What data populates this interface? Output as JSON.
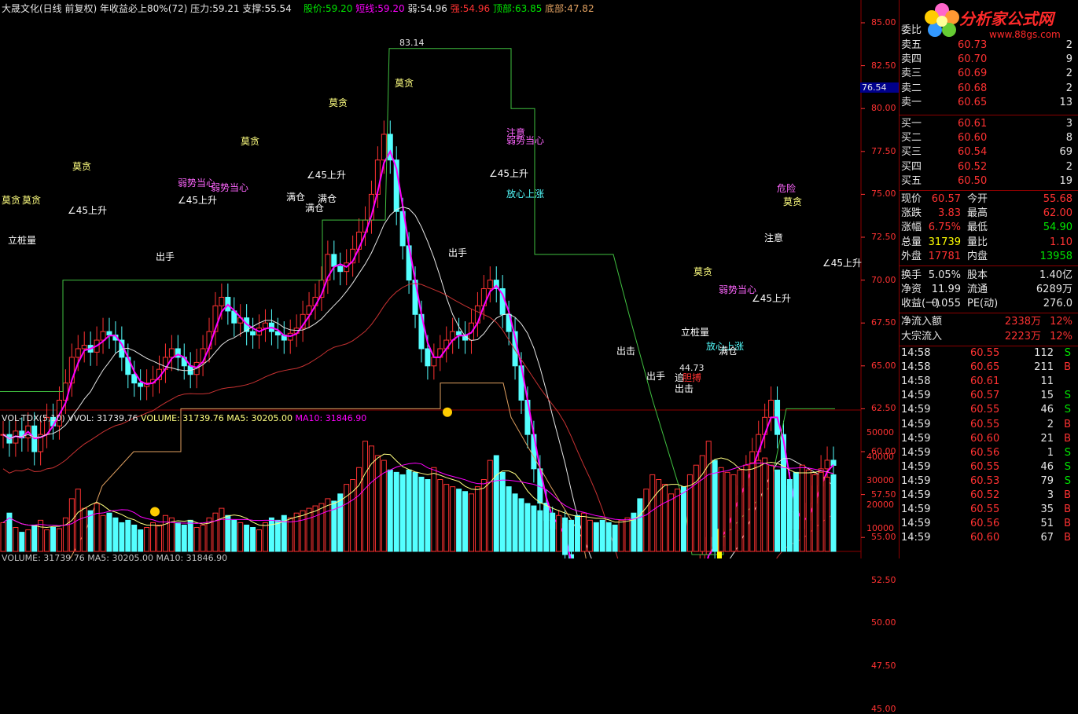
{
  "header": {
    "stock": "大晟文化(日线 前复权)",
    "indicator": "年收益必上80%(72)",
    "pressure_label": "压力:",
    "pressure": "59.21",
    "support_label": "支撑:",
    "support": "55.54",
    "price_label": "股价:",
    "price": "59.20",
    "short_label": "短线:",
    "short": "59.20",
    "weak_label": "弱:",
    "weak": "54.96",
    "strong_label": "强:",
    "strong": "54.96",
    "top_label": "顶部:",
    "top": "63.85",
    "bottom_label": "底部:",
    "bottom": "47.82"
  },
  "price_axis": [
    "85.00",
    "82.50",
    "80.00",
    "77.50",
    "75.00",
    "72.50",
    "70.00",
    "67.50",
    "65.00",
    "62.50",
    "60.00",
    "57.50",
    "55.00",
    "52.50",
    "50.00",
    "47.50",
    "45.00"
  ],
  "price_marker": "76.54",
  "volume_axis": [
    "50000",
    "40000",
    "30000",
    "20000",
    "10000"
  ],
  "volume_header": {
    "name": "VOL-TDX(5,10)",
    "vvol": "VVOL: 31739.76",
    "volume": "VOLUME: 31739.76",
    "ma5": "MA5: 30205.00",
    "ma10": "MA10: 31846.90"
  },
  "volume_footer": "VOLUME: 31739.76  MA5: 30205.00  MA10: 31846.90",
  "annotations": {
    "high": "83.14",
    "low": "44.73",
    "labels": [
      "莫贪",
      "莫贪",
      "立桩量",
      "莫贪",
      "∠45上升",
      "出手",
      "莫贪",
      "弱势当心",
      "∠45上升",
      "弱势当心",
      "满仓",
      "满仓",
      "满仓",
      "莫贪",
      "∠45上升",
      "莫贪",
      "出手",
      "注意",
      "弱势当心",
      "∠45上升",
      "放心上涨",
      "出击",
      "出手",
      "追",
      "胆搏",
      "出击",
      "立桩量",
      "莫贪",
      "弱势当心",
      "放心上涨",
      "满仓",
      "∠45上升",
      "注意",
      "危险",
      "莫贪",
      "∠45上升"
    ]
  },
  "logo": {
    "title": "分析家公式网",
    "url": "www.88gs.com"
  },
  "order_book": {
    "title": "委比",
    "asks": [
      {
        "label": "卖五",
        "price": "60.73",
        "vol": "2"
      },
      {
        "label": "卖四",
        "price": "60.70",
        "vol": "9"
      },
      {
        "label": "卖三",
        "price": "60.69",
        "vol": "2"
      },
      {
        "label": "卖二",
        "price": "60.68",
        "vol": "2"
      },
      {
        "label": "卖一",
        "price": "60.65",
        "vol": "13"
      }
    ],
    "bids": [
      {
        "label": "买一",
        "price": "60.61",
        "vol": "3"
      },
      {
        "label": "买二",
        "price": "60.60",
        "vol": "8"
      },
      {
        "label": "买三",
        "price": "60.54",
        "vol": "69"
      },
      {
        "label": "买四",
        "price": "60.52",
        "vol": "2"
      },
      {
        "label": "买五",
        "price": "60.50",
        "vol": "19"
      }
    ]
  },
  "quote": [
    {
      "l1": "现价",
      "v1": "60.57",
      "l2": "今开",
      "v2": "55.68",
      "c1": "red",
      "c2": "red"
    },
    {
      "l1": "涨跌",
      "v1": "3.83",
      "l2": "最高",
      "v2": "62.00",
      "c1": "red",
      "c2": "red"
    },
    {
      "l1": "涨幅",
      "v1": "6.75%",
      "l2": "最低",
      "v2": "54.90",
      "c1": "red",
      "c2": "green"
    },
    {
      "l1": "总量",
      "v1": "31739",
      "l2": "量比",
      "v2": "1.10",
      "c1": "yellow",
      "c2": "red"
    },
    {
      "l1": "外盘",
      "v1": "17781",
      "l2": "内盘",
      "v2": "13958",
      "c1": "red",
      "c2": "green"
    }
  ],
  "fundamentals": [
    {
      "l1": "换手",
      "v1": "5.05%",
      "l2": "股本",
      "v2": "1.40亿"
    },
    {
      "l1": "净资",
      "v1": "11.99",
      "l2": "流通",
      "v2": "6289万"
    },
    {
      "l1": "收益(一)",
      "v1": "0.055",
      "l2": "PE(动)",
      "v2": "276.0"
    }
  ],
  "flows": [
    {
      "label": "净流入额",
      "value": "2338万",
      "pct": "12%"
    },
    {
      "label": "大宗流入",
      "value": "2223万",
      "pct": "12%"
    }
  ],
  "ticks": [
    {
      "time": "14:58",
      "price": "60.55",
      "vol": "112",
      "side": "S"
    },
    {
      "time": "14:58",
      "price": "60.65",
      "vol": "211",
      "side": "B"
    },
    {
      "time": "14:58",
      "price": "60.61",
      "vol": "11",
      "side": ""
    },
    {
      "time": "14:59",
      "price": "60.57",
      "vol": "15",
      "side": "S"
    },
    {
      "time": "14:59",
      "price": "60.55",
      "vol": "46",
      "side": "S"
    },
    {
      "time": "14:59",
      "price": "60.55",
      "vol": "2",
      "side": "B"
    },
    {
      "time": "14:59",
      "price": "60.60",
      "vol": "21",
      "side": "B"
    },
    {
      "time": "14:59",
      "price": "60.56",
      "vol": "1",
      "side": "S"
    },
    {
      "time": "14:59",
      "price": "60.55",
      "vol": "46",
      "side": "S"
    },
    {
      "time": "14:59",
      "price": "60.53",
      "vol": "79",
      "side": "S"
    },
    {
      "time": "14:59",
      "price": "60.52",
      "vol": "3",
      "side": "B"
    },
    {
      "time": "14:59",
      "price": "60.55",
      "vol": "35",
      "side": "B"
    },
    {
      "time": "14:59",
      "price": "60.56",
      "vol": "51",
      "side": "B"
    },
    {
      "time": "14:59",
      "price": "60.60",
      "vol": "67",
      "side": "B"
    }
  ],
  "colors": {
    "up": "#ff3232",
    "down": "#54ffff",
    "ma": "#ff00ff",
    "short": "#00ff00",
    "green_line": "#40c040",
    "orange_line": "#e0a060",
    "white_line": "#e6e6e6",
    "vol_ma5": "#ffff80",
    "vol_ma10": "#ff00ff"
  }
}
